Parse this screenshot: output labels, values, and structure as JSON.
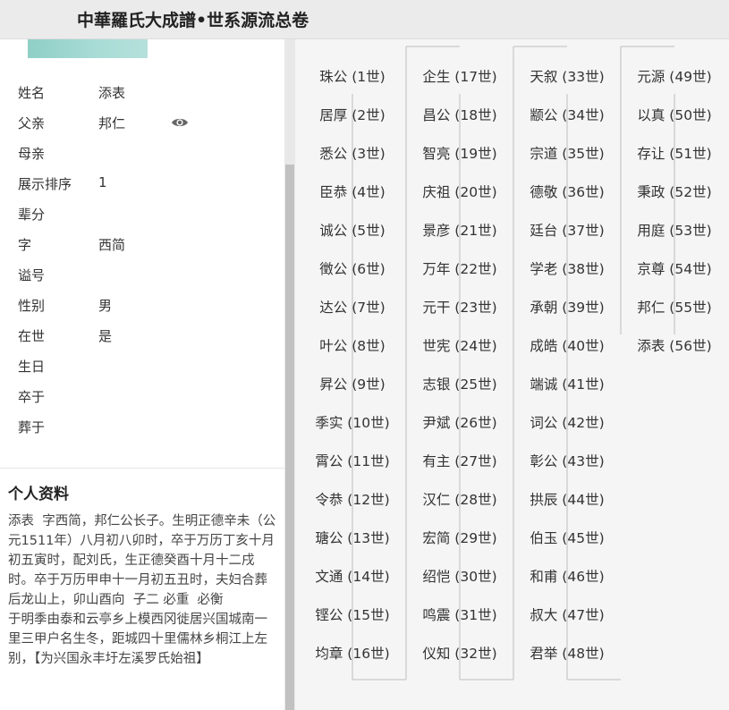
{
  "header": {
    "title": "中華羅氏大成譜•世系源流总卷"
  },
  "person": {
    "fields": [
      {
        "label": "姓名",
        "value": "添表"
      },
      {
        "label": "父亲",
        "value": "邦仁"
      },
      {
        "label": "母亲",
        "value": ""
      },
      {
        "label": "展示排序",
        "value": "1"
      },
      {
        "label": "辈分",
        "value": ""
      },
      {
        "label": "字",
        "value": "西简"
      },
      {
        "label": "谥号",
        "value": ""
      },
      {
        "label": "性别",
        "value": "男"
      },
      {
        "label": "在世",
        "value": "是"
      },
      {
        "label": "生日",
        "value": ""
      },
      {
        "label": "卒于",
        "value": ""
      },
      {
        "label": "葬于",
        "value": ""
      }
    ],
    "view_icon": "eye-icon"
  },
  "profile": {
    "title": "个人资料",
    "text": "添表  字西简，邦仁公长子。生明正德辛未（公元1511年）八月初八卯时，卒于万历丁亥十月初五寅时，配刘氏，生正德癸酉十月十二戌时。卒于万历甲申十一月初五丑时，夫妇合葬后龙山上，卯山酉向  子二 必重  必衡\n于明季由泰和云亭乡上模西冈徙居兴国城南一里三甲户名生冬，距城四十里儒林乡桐江上左别，【为兴国永丰圩左溪罗氏始祖】"
  },
  "generations": [
    [
      "珠公 (1世)",
      "居厚 (2世)",
      "悉公 (3世)",
      "臣恭 (4世)",
      "诚公 (5世)",
      "徵公 (6世)",
      "达公 (7世)",
      "叶公 (8世)",
      "昇公 (9世)",
      "季实 (10世)",
      "霄公 (11世)",
      "令恭 (12世)",
      "瑭公 (13世)",
      "文通 (14世)",
      "铿公 (15世)",
      "均章 (16世)"
    ],
    [
      "企生 (17世)",
      "昌公 (18世)",
      "智亮 (19世)",
      "庆祖 (20世)",
      "景彦 (21世)",
      "万年 (22世)",
      "元干 (23世)",
      "世宪 (24世)",
      "志银 (25世)",
      "尹斌 (26世)",
      "有主 (27世)",
      "汉仁 (28世)",
      "宏简 (29世)",
      "绍恺 (30世)",
      "鸣震 (31世)",
      "仪知 (32世)"
    ],
    [
      "天叙 (33世)",
      "颛公 (34世)",
      "宗道 (35世)",
      "德敬 (36世)",
      "廷台 (37世)",
      "学老 (38世)",
      "承朝 (39世)",
      "成皓 (40世)",
      "端诚 (41世)",
      "词公 (42世)",
      "彰公 (43世)",
      "拱辰 (44世)",
      "伯玉 (45世)",
      "和甫 (46世)",
      "叔大 (47世)",
      "君举 (48世)"
    ],
    [
      "元源 (49世)",
      "以真 (50世)",
      "存让 (51世)",
      "秉政 (52世)",
      "用庭 (53世)",
      "京尊 (54世)",
      "邦仁 (55世)",
      "添表 (56世)"
    ]
  ]
}
